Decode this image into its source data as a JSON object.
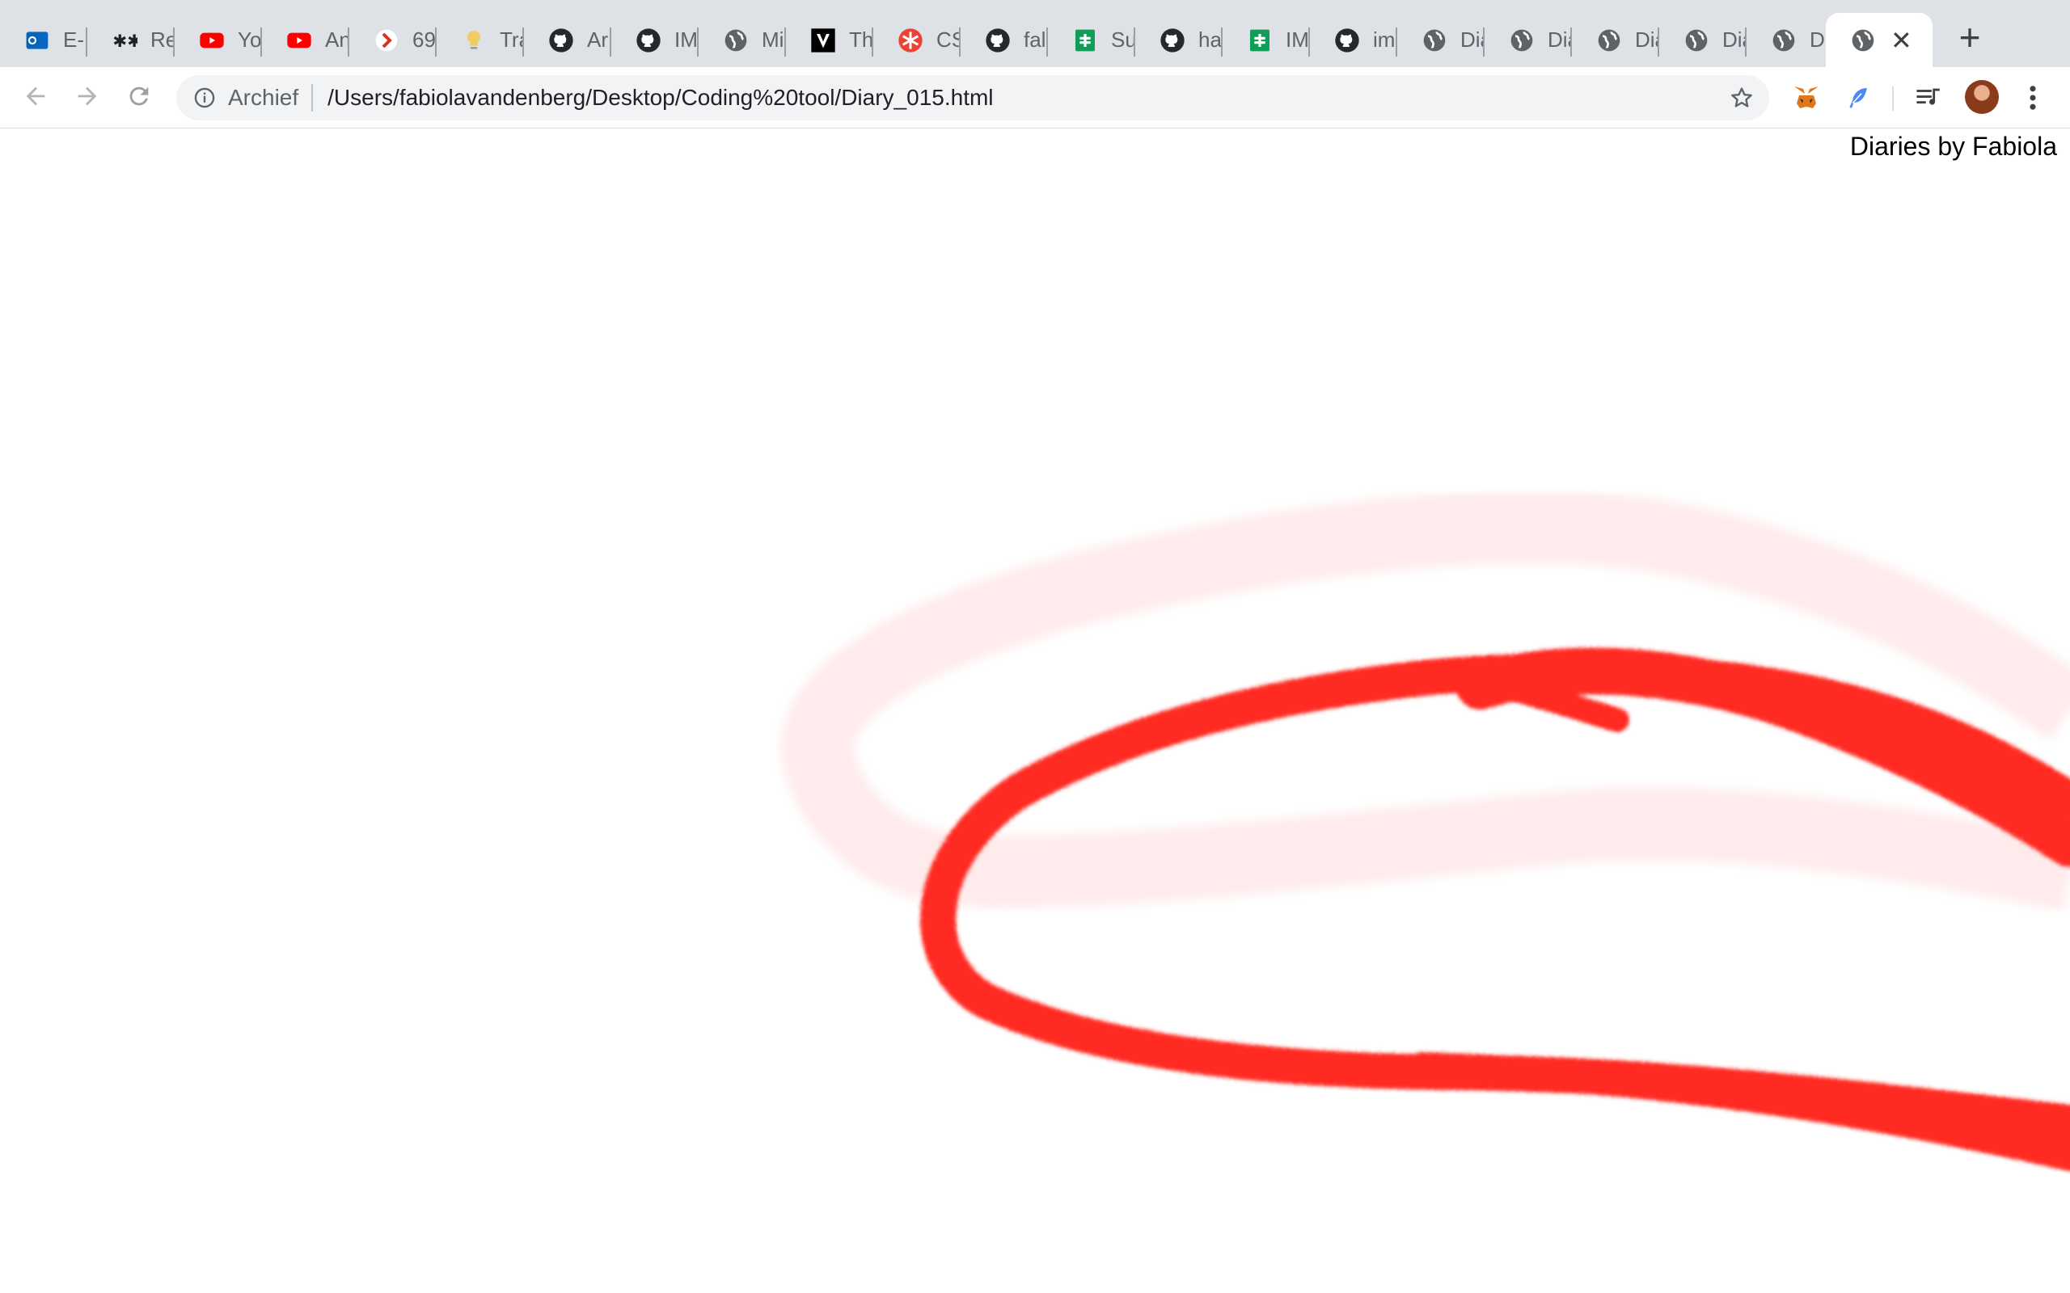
{
  "tabs": [
    {
      "title": "E-",
      "icon": "outlook-icon",
      "color": "#0a66c2"
    },
    {
      "title": "Re",
      "icon": "asterisk-pair-icon",
      "color": "#202124"
    },
    {
      "title": "Yo",
      "icon": "youtube-icon",
      "color": "#ff0000"
    },
    {
      "title": "An",
      "icon": "youtube-icon",
      "color": "#ff0000"
    },
    {
      "title": "69",
      "icon": "chevron-red-icon",
      "color": "#d93025"
    },
    {
      "title": "Tra",
      "icon": "lightbulb-icon",
      "color": "#f2c94c"
    },
    {
      "title": "Ar",
      "icon": "github-icon",
      "color": "#24292e"
    },
    {
      "title": "IM",
      "icon": "github-icon",
      "color": "#24292e"
    },
    {
      "title": "Mi",
      "icon": "globe-icon",
      "color": "#5f6368"
    },
    {
      "title": "Th",
      "icon": "v-logo-icon",
      "color": "#000000"
    },
    {
      "title": "CS",
      "icon": "asterisk-red-icon",
      "color": "#ea4335"
    },
    {
      "title": "fal",
      "icon": "github-icon",
      "color": "#24292e"
    },
    {
      "title": "Su",
      "icon": "sheets-icon",
      "color": "#0f9d58"
    },
    {
      "title": "ha",
      "icon": "github-icon",
      "color": "#24292e"
    },
    {
      "title": "IM",
      "icon": "sheets-icon",
      "color": "#0f9d58"
    },
    {
      "title": "im",
      "icon": "github-icon",
      "color": "#24292e"
    },
    {
      "title": "Dia",
      "icon": "globe-icon",
      "color": "#5f6368"
    },
    {
      "title": "Dia",
      "icon": "globe-icon",
      "color": "#5f6368"
    },
    {
      "title": "Dia",
      "icon": "globe-icon",
      "color": "#5f6368"
    },
    {
      "title": "Dia",
      "icon": "globe-icon",
      "color": "#5f6368"
    },
    {
      "title": "Dia",
      "icon": "globe-icon",
      "color": "#5f6368"
    },
    {
      "title": "",
      "icon": "globe-icon",
      "color": "#5f6368",
      "active": true
    }
  ],
  "new_tab_label": "+",
  "close_tab_glyph": "✕",
  "toolbar": {
    "back_icon": "arrow-left-icon",
    "forward_icon": "arrow-right-icon",
    "reload_icon": "reload-icon"
  },
  "omnibox": {
    "security_label": "Archief",
    "url": "/Users/fabiolavandenberg/Desktop/Coding%20tool/Diary_015.html",
    "bookmark_icon": "star-icon"
  },
  "extensions": [
    {
      "name": "metamask-icon",
      "color": "#e2761b"
    },
    {
      "name": "feather-icon",
      "color": "#4285f4"
    },
    {
      "name": "media-queue-icon",
      "color": "#3c4043"
    }
  ],
  "page": {
    "byline": "Diaries by Fabiola",
    "stroke_color": "#ff2a22"
  }
}
